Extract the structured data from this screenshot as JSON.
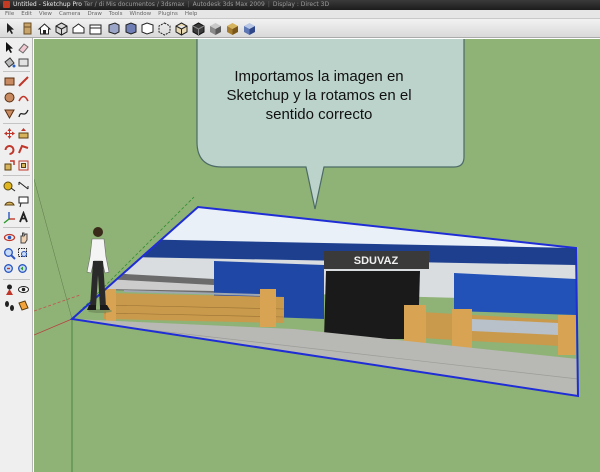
{
  "window": {
    "title": "Untitled - Sketchup Pro",
    "background_titles": [
      "Ter / di Mis documentos / 3dsmax",
      "Autodesk 3ds Max 2009",
      "Display : Direct 3D"
    ]
  },
  "menu": {
    "items": [
      "File",
      "Edit",
      "View",
      "Camera",
      "Draw",
      "Tools",
      "Window",
      "Plugins",
      "Help"
    ]
  },
  "toolbar": {
    "buttons": [
      "select-icon",
      "component-icon",
      "house-icon",
      "iso-view-icon",
      "top-view-icon",
      "front-view-icon",
      "right-view-icon",
      "back-view-icon",
      "left-view-icon",
      "xray-style-icon",
      "wireframe-style-icon",
      "hidden-line-style-icon",
      "shaded-style-icon",
      "shaded-texture-style-icon",
      "monochrome-style-icon"
    ]
  },
  "left_toolbar": {
    "tools": [
      "select-tool",
      "eraser-tool",
      "paint-bucket-tool",
      "rectangle-tool",
      "line-tool",
      "circle-tool",
      "arc-tool",
      "polygon-tool",
      "freehand-tool",
      "move-tool",
      "push-pull-tool",
      "rotate-tool",
      "follow-me-tool",
      "scale-tool",
      "offset-tool",
      "tape-measure-tool",
      "dimension-tool",
      "protractor-tool",
      "text-tool",
      "axes-tool",
      "3d-text-tool",
      "orbit-tool",
      "pan-tool",
      "zoom-tool",
      "zoom-window-tool",
      "zoom-extents-tool",
      "previous-view-tool",
      "position-camera-tool",
      "look-around-tool",
      "walk-tool",
      "section-plane-tool",
      "footprints-tool"
    ]
  },
  "viewport": {
    "background_color": "#8fb276",
    "selection_color": "#1f2dd6",
    "axis_green_color": "#2f8f2f",
    "axis_red_color": "#b84040"
  },
  "callout": {
    "lines": [
      "Importamos la imagen en",
      "Sketchup y la rotamos en el",
      "sentido correcto"
    ],
    "fill_color": "#bcd3cc"
  }
}
